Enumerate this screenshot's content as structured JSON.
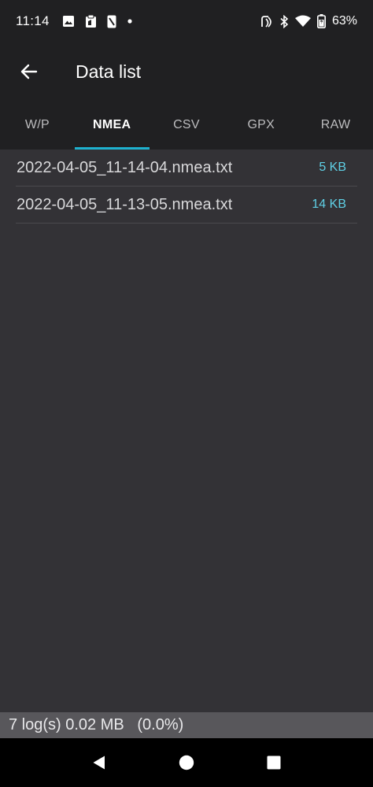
{
  "status_bar": {
    "time": "11:14",
    "left_icons": [
      "image-icon",
      "clipboard-icon",
      "phone-frame-icon",
      "dot-icon"
    ],
    "right_icons": [
      "nfc-icon",
      "bluetooth-icon",
      "wifi-icon",
      "battery-icon"
    ],
    "battery": "63%"
  },
  "app_bar": {
    "back_icon": "arrow-left-icon",
    "title": "Data list"
  },
  "tabs": [
    {
      "label": "W/P",
      "active": false
    },
    {
      "label": "NMEA",
      "active": true
    },
    {
      "label": "CSV",
      "active": false
    },
    {
      "label": "GPX",
      "active": false
    },
    {
      "label": "RAW",
      "active": false
    }
  ],
  "files": [
    {
      "name": "2022-04-05_11-14-04.nmea.txt",
      "size": "5 KB"
    },
    {
      "name": "2022-04-05_11-13-05.nmea.txt",
      "size": "14 KB"
    }
  ],
  "footer": {
    "summary": "7 log(s) 0.02 MB   (0.0%)"
  },
  "nav_bar": {
    "icons": [
      "back-triangle-icon",
      "home-circle-icon",
      "recents-square-icon"
    ]
  },
  "colors": {
    "accent": "#1eb1cf",
    "size_text": "#5fd0e6",
    "background": "#202022",
    "content": "#333236",
    "footer": "#58575b"
  }
}
